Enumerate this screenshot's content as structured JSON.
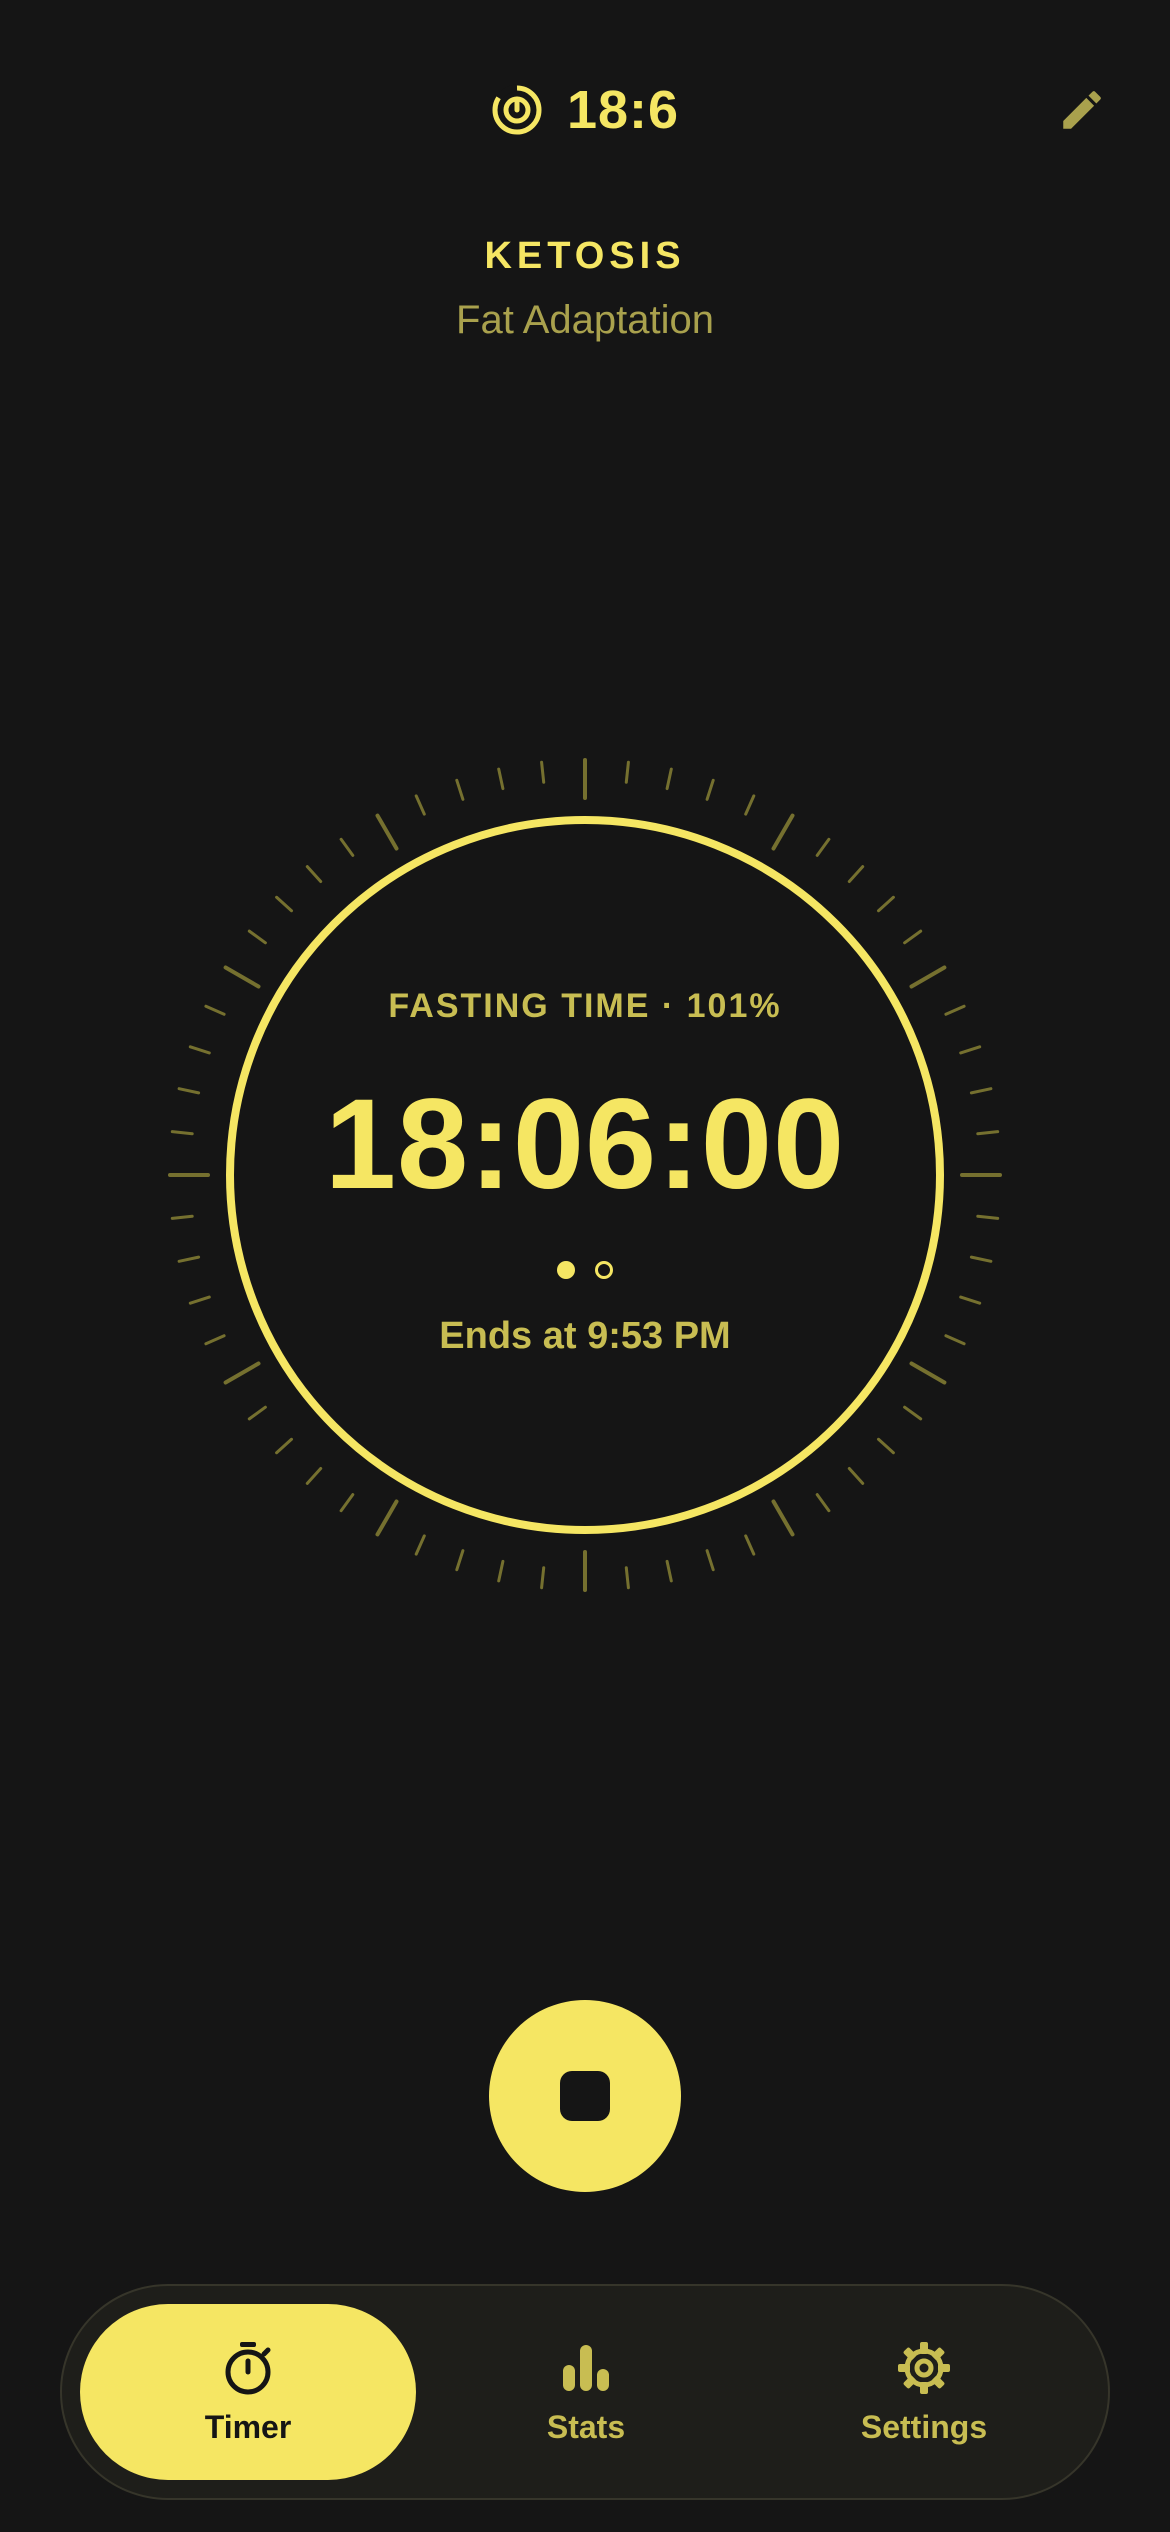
{
  "header": {
    "brand_value": "18:6",
    "brand_icon": "fasting-target-icon",
    "edit_icon": "pencil-icon"
  },
  "stage": {
    "title": "KETOSIS",
    "subtitle": "Fat Adaptation"
  },
  "dial": {
    "label": "FASTING TIME · 101%",
    "time": "18:06:00",
    "ends": "Ends at 9:53 PM",
    "progress_percent": 101,
    "page_dots": [
      true,
      false
    ]
  },
  "actions": {
    "stop_icon": "stop-icon"
  },
  "nav": {
    "items": [
      {
        "label": "Timer",
        "icon": "stopwatch-icon",
        "active": true
      },
      {
        "label": "Stats",
        "icon": "bar-chart-icon",
        "active": false
      },
      {
        "label": "Settings",
        "icon": "gear-icon",
        "active": false
      }
    ]
  },
  "colors": {
    "accent": "#F5E663",
    "accent_muted": "#C8BD52",
    "background": "#151515",
    "nav_background": "#1E1E1A"
  }
}
